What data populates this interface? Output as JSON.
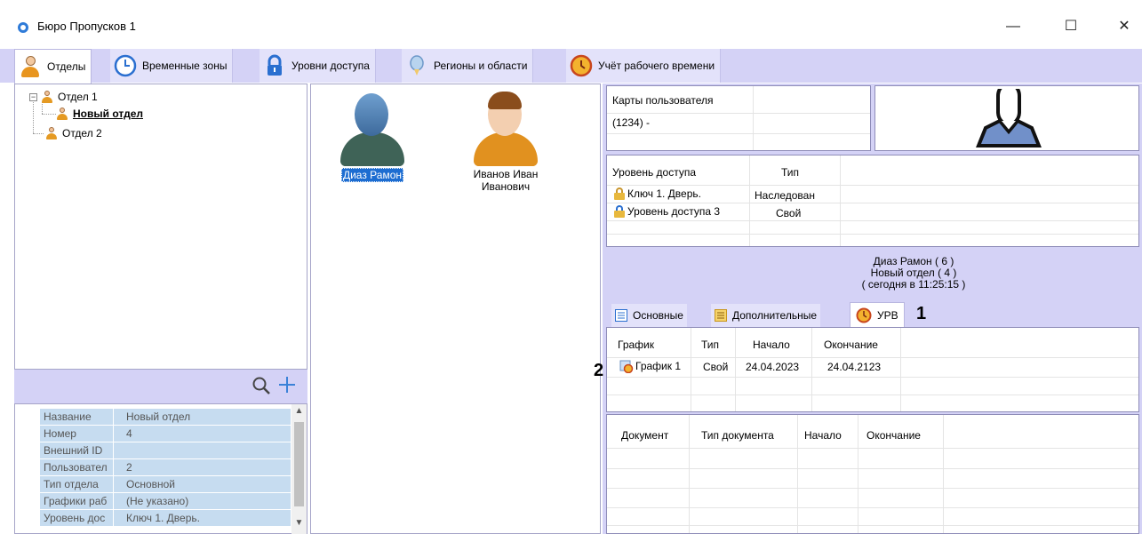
{
  "window": {
    "title": "Бюро Пропусков 1",
    "min": "—",
    "max": "☐",
    "close": "✕"
  },
  "tabs": [
    {
      "label": "Отделы",
      "icon": "person-icon"
    },
    {
      "label": "Временные зоны",
      "icon": "clock-icon"
    },
    {
      "label": "Уровни доступа",
      "icon": "lock-icon"
    },
    {
      "label": "Регионы и области",
      "icon": "region-pin-icon"
    },
    {
      "label": "Учёт рабочего времени",
      "icon": "time-tracking-icon"
    }
  ],
  "tree": [
    {
      "label": "Отдел 1"
    },
    {
      "label": "Новый отдел"
    },
    {
      "label": "Отдел 2"
    }
  ],
  "properties": [
    {
      "key": "Название",
      "value": "Новый отдел"
    },
    {
      "key": "Номер",
      "value": "4"
    },
    {
      "key": "Внешний ID",
      "value": ""
    },
    {
      "key": "Пользовател",
      "value": "2"
    },
    {
      "key": "Тип отдела",
      "value": "Основной"
    },
    {
      "key": "Графики раб",
      "value": "(Не указано)"
    },
    {
      "key": "Уровень дос",
      "value": "Ключ 1. Дверь."
    }
  ],
  "users": [
    {
      "name": "Диаз Рамон",
      "name2": ""
    },
    {
      "name": "Иванов Иван",
      "name2": "Иванович"
    }
  ],
  "cards": {
    "header": "Карты пользователя",
    "rows": [
      "(1234) -"
    ]
  },
  "access": {
    "headers": [
      "Уровень доступа",
      "Тип"
    ],
    "rows": [
      {
        "level": "Ключ 1. Дверь.",
        "type": "Наследован"
      },
      {
        "level": "Уровень доступа 3",
        "type": "Свой"
      }
    ]
  },
  "user_info": {
    "line1": "Диаз Рамон ( 6 )",
    "line2": "Новый отдел ( 4 )",
    "line3": "( сегодня в 11:25:15 )"
  },
  "subtabs": [
    {
      "label": "Основные",
      "icon": "list-icon"
    },
    {
      "label": "Дополнительные",
      "icon": "list-icon"
    },
    {
      "label": "УРВ",
      "icon": "time-tracking-icon"
    }
  ],
  "callouts": {
    "one": "1",
    "two": "2"
  },
  "schedule": {
    "headers": [
      "График",
      "Тип",
      "Начало",
      "Окончание"
    ],
    "rows": [
      {
        "name": "График 1",
        "type": "Свой",
        "start": "24.04.2023",
        "end": "24.04.2123"
      }
    ]
  },
  "documents": {
    "headers": [
      "Документ",
      "Тип документа",
      "Начало",
      "Окончание"
    ]
  }
}
